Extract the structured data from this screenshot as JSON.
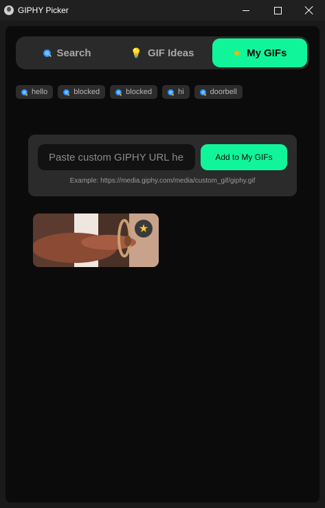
{
  "window": {
    "title": "GIPHY Picker"
  },
  "tabs": [
    {
      "label": "Search",
      "icon": "search-icon"
    },
    {
      "label": "GIF Ideas",
      "icon": "lightbulb-icon"
    },
    {
      "label": "My GIFs",
      "icon": "star-icon",
      "active": true
    }
  ],
  "recent_searches": [
    "hello",
    "blocked",
    "blocked",
    "hi",
    "doorbell"
  ],
  "custom": {
    "placeholder": "Paste custom GIPHY URL here",
    "button_label": "Add to My GIFs",
    "example": "Example: https://media.giphy.com/media/custom_gif/giphy.gif"
  },
  "colors": {
    "accent": "#11f59a",
    "panel": "#0b0b0b",
    "surface": "#2b2b2b"
  }
}
